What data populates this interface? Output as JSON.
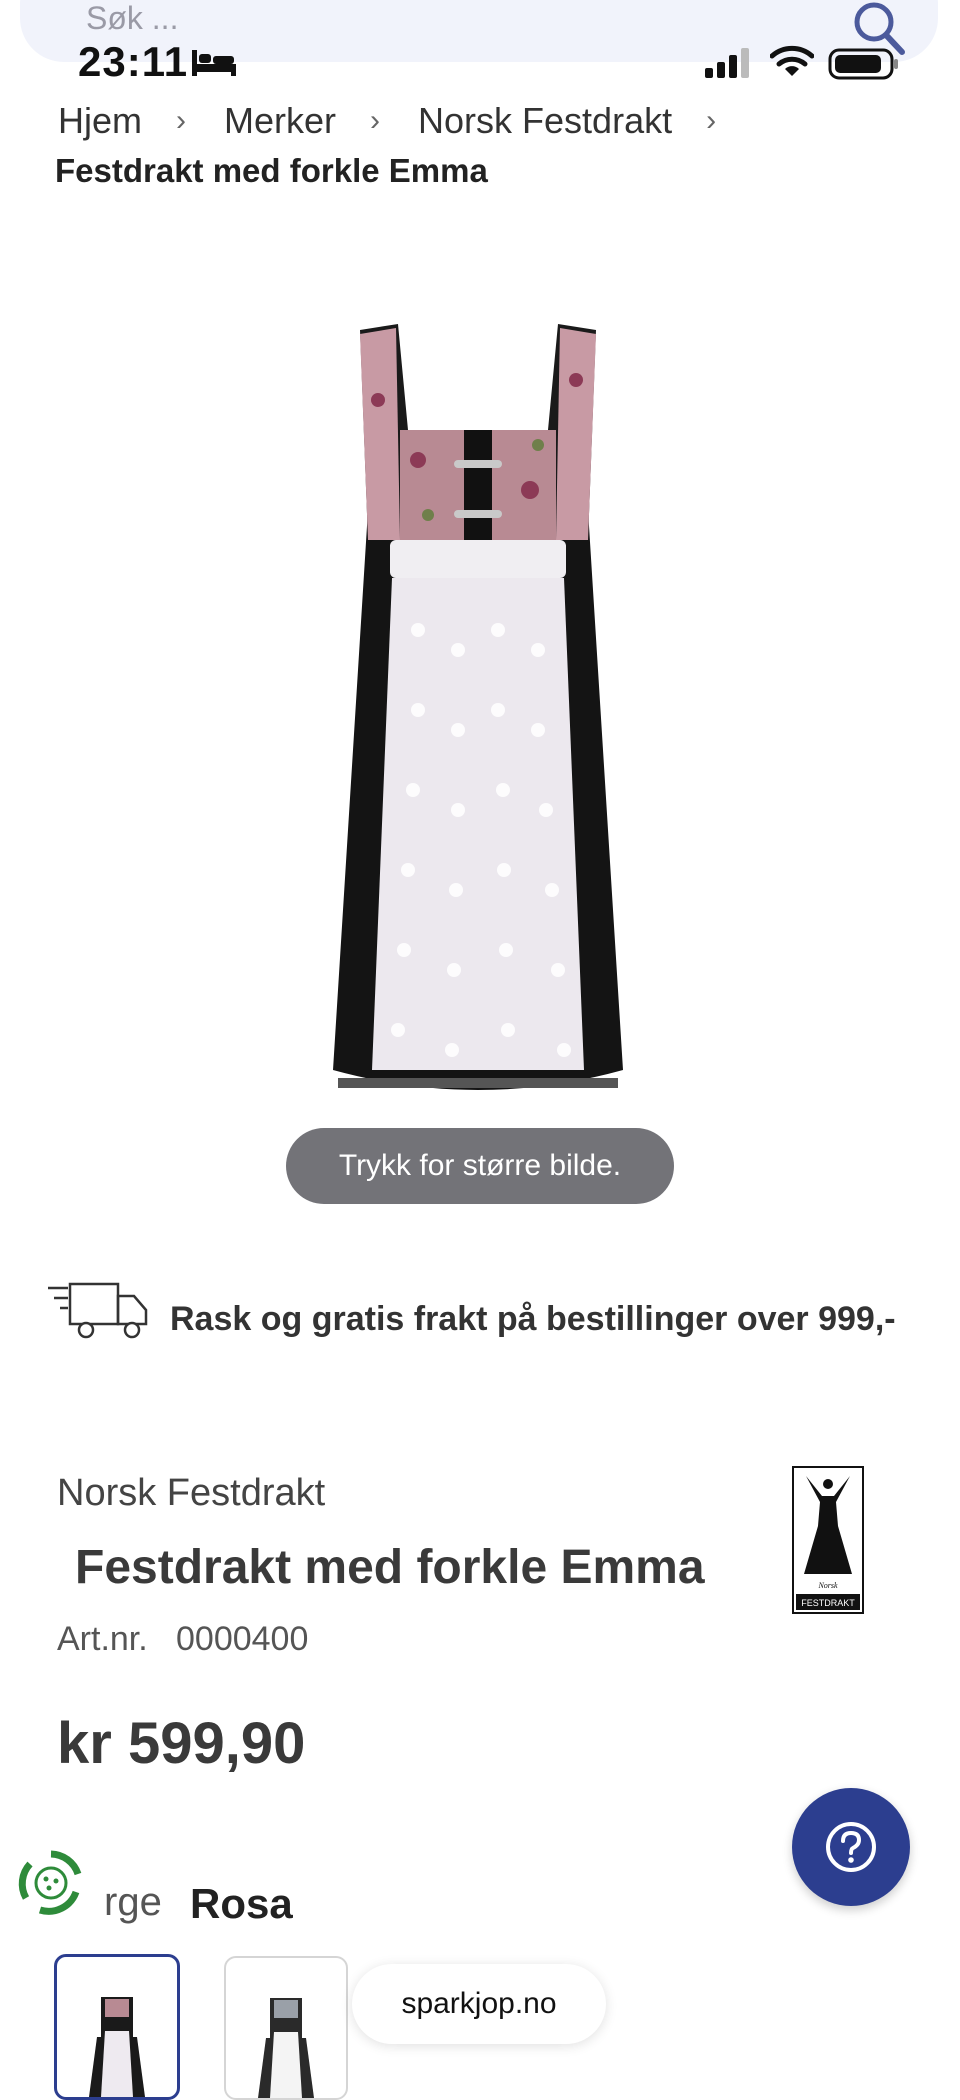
{
  "search": {
    "placeholder": "Søk ..."
  },
  "status_bar": {
    "time": "23:11"
  },
  "breadcrumb": {
    "items": [
      "Hjem",
      "Merker",
      "Norsk Festdrakt"
    ],
    "current": "Festdrakt med forkle Emma"
  },
  "image": {
    "zoom_hint": "Trykk for større bilde."
  },
  "shipping": {
    "text": "Rask og gratis frakt på bestillinger over 999,-"
  },
  "product": {
    "brand": "Norsk Festdrakt",
    "title": "Festdrakt med forkle Emma",
    "artnr_label": "Art.nr.",
    "artnr": "0000400",
    "price": "kr 599,90",
    "color_label": "rge",
    "color_value": "Rosa"
  },
  "brand_logo_text": {
    "small": "Norsk",
    "big": "FESTDRAKT"
  },
  "browser": {
    "domain": "sparkjop.no"
  },
  "colors": {
    "accent": "#2c3e8f",
    "text": "#2b2b2b",
    "search_bg": "#f1f3fb"
  },
  "icons": [
    "search-icon",
    "bed-icon",
    "signal-icon",
    "wifi-icon",
    "battery-icon",
    "truck-icon",
    "question-icon",
    "recycle-icon"
  ]
}
